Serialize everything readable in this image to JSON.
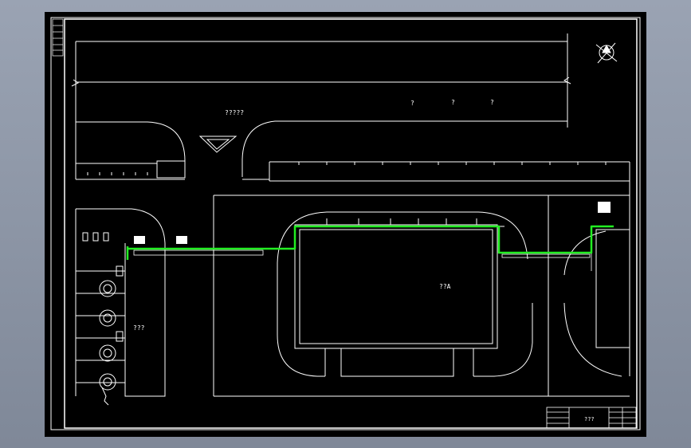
{
  "labels": {
    "road_label": "?????",
    "mark_1": "?",
    "mark_2": "?",
    "mark_3": "?",
    "tank_area_label": "???",
    "building_label": "??A"
  },
  "title_block": {
    "center_text": "???"
  },
  "colors": {
    "sheet_background": "#000000",
    "line_color": "#ffffff",
    "pipe_color": "#22ee22",
    "viewport_border": "#9aa3b3"
  },
  "icons": {
    "north_arrow": "compass-north-arrow-icon",
    "flow_arrow": "triangle-arrow-icon"
  }
}
